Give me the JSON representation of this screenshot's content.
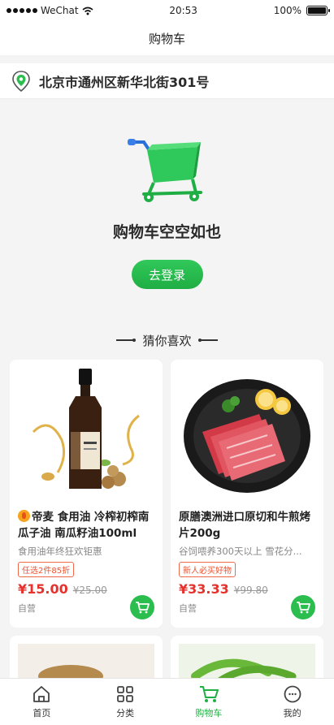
{
  "status_bar": {
    "carrier": "WeChat",
    "time": "20:53",
    "battery": "100%",
    "battery_level": 1.0
  },
  "nav": {
    "title": "购物车"
  },
  "address": {
    "text": "北京市通州区新华北街301号",
    "icon": "location-pin-icon"
  },
  "empty_cart": {
    "title": "购物车空空如也",
    "login_label": "去登录",
    "illustration": "shopping-cart-icon"
  },
  "recommend": {
    "title": "猜你喜欢"
  },
  "products": [
    {
      "title": "帝麦 食用油 冷榨初榨南瓜子油 南瓜籽油100ml",
      "subtitle": "食用油年终狂欢钜惠",
      "tag": "任选2件85折",
      "price": "¥15.00",
      "old_price": "¥25.00",
      "self_operated": "自营",
      "image": "oil-bottle-image"
    },
    {
      "title": "原膳澳洲进口原切和牛煎烤片200g",
      "subtitle": "谷饲喂养300天以上 雪花分...",
      "tag": "新人必买好物",
      "price": "¥33.33",
      "old_price": "¥99.80",
      "self_operated": "自营",
      "image": "beef-slices-image"
    }
  ],
  "tabs": [
    {
      "label": "首页",
      "icon": "home-icon"
    },
    {
      "label": "分类",
      "icon": "grid-icon"
    },
    {
      "label": "购物车",
      "icon": "cart-icon",
      "active": true
    },
    {
      "label": "我的",
      "icon": "profile-icon"
    }
  ],
  "colors": {
    "accent": "#1fae43",
    "price": "#e5322d",
    "tag": "#f0522e"
  }
}
